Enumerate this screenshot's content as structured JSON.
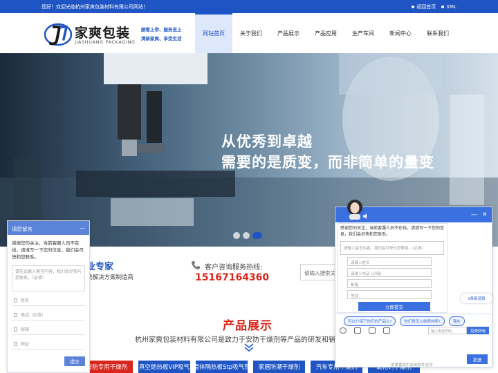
{
  "topbar": {
    "welcome": "您好！欢迎光临杭州家爽包装材料有限公司网站！",
    "home_link": "返回首页",
    "xml_link": "XML"
  },
  "brand": {
    "name_cn": "家爽包装",
    "name_en": "JIASHUANG PACKAGING",
    "slogan_line1": "顾客上帝、服务至上",
    "slogan_line2": "清新家爽、享受生活"
  },
  "nav": {
    "items": [
      {
        "label": "网站首页"
      },
      {
        "label": "关于我们"
      },
      {
        "label": "产品展示"
      },
      {
        "label": "产品应用"
      },
      {
        "label": "生产车间"
      },
      {
        "label": "新闻中心"
      },
      {
        "label": "联系我们"
      }
    ]
  },
  "hero": {
    "headline1": "从优秀到卓越",
    "headline2": "需要的是质变，而非简单的量变"
  },
  "info": {
    "expert_title": "业专家",
    "expert_sub": "统解决方案制造商",
    "hotline_label": "客户咨询服务热线:",
    "hotline_number": "15167164360",
    "search_placeholder": "请输入搜索关键"
  },
  "products": {
    "title": "产品展示",
    "description": "杭州家爽包装材料有限公司是致力于安防干燥剂等产品的研发和销",
    "tabs": [
      {
        "label": "安防专用干燥剂"
      },
      {
        "label": "真空绝热板VIP吸气"
      },
      {
        "label": "墙体隔热板Stp吸气剂"
      },
      {
        "label": "家居防潮干燥剂"
      },
      {
        "label": "汽车专用干燥剂"
      },
      {
        "label": "氧化钙干燥剂"
      }
    ]
  },
  "message_widget": {
    "title": "请您留言",
    "close": "—",
    "intro": "感谢您的关注，当前客服人员不在线，请填写一下您的信息，我们会尽快和您联系。",
    "content_placeholder": "请在此输入留言内容，我们会尽快与您联系。（必填）",
    "fields": [
      "姓名",
      "电话（必填）",
      "邮箱",
      "地址"
    ],
    "submit": "提交"
  },
  "chat_widget": {
    "minimize": "—",
    "close": "✕",
    "intro": "感谢您的关注，当前客服人员不在线，请填写一下您的信息，我们会尽快和您联系。",
    "content_placeholder": "请输入留言内容，我们会尽快与您联系。(必填)",
    "fields": [
      "请输入姓名",
      "请输入电话 (必填)",
      "邮箱",
      "地址"
    ],
    "submit": "立即提交",
    "new_message": "1条新消息",
    "quick_replies": [
      "可以介绍下你们的产品么?",
      "你们是怎么收费的呢?",
      "我在"
    ],
    "tel_placeholder": "输入电话号码",
    "tel_button": "免费回电",
    "send": "发送",
    "powered": "爱番番提供咨询软件支持"
  },
  "colors": {
    "primary_blue": "#1f54c4",
    "accent_red": "#d9261c"
  }
}
